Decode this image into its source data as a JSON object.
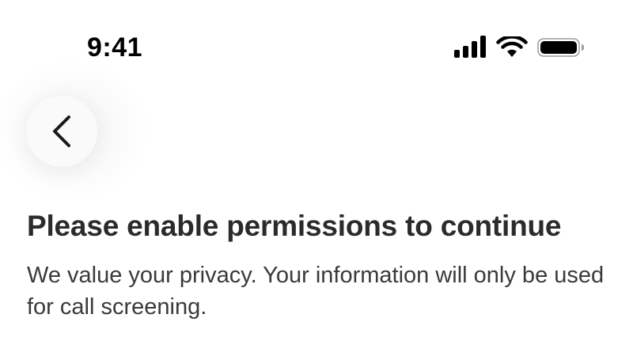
{
  "status_bar": {
    "time": "9:41",
    "icons": [
      "cellular-signal-icon",
      "wifi-icon",
      "battery-icon"
    ]
  },
  "nav": {
    "back_icon": "chevron-left-icon"
  },
  "content": {
    "title": "Please enable permissions to continue",
    "subtitle": "We value your privacy. Your information will only be used for call screening."
  },
  "colors": {
    "background": "#ffffff",
    "title": "#2b2b2b",
    "subtitle": "#3a3a3a",
    "back_button_bg": "#fafafa"
  }
}
